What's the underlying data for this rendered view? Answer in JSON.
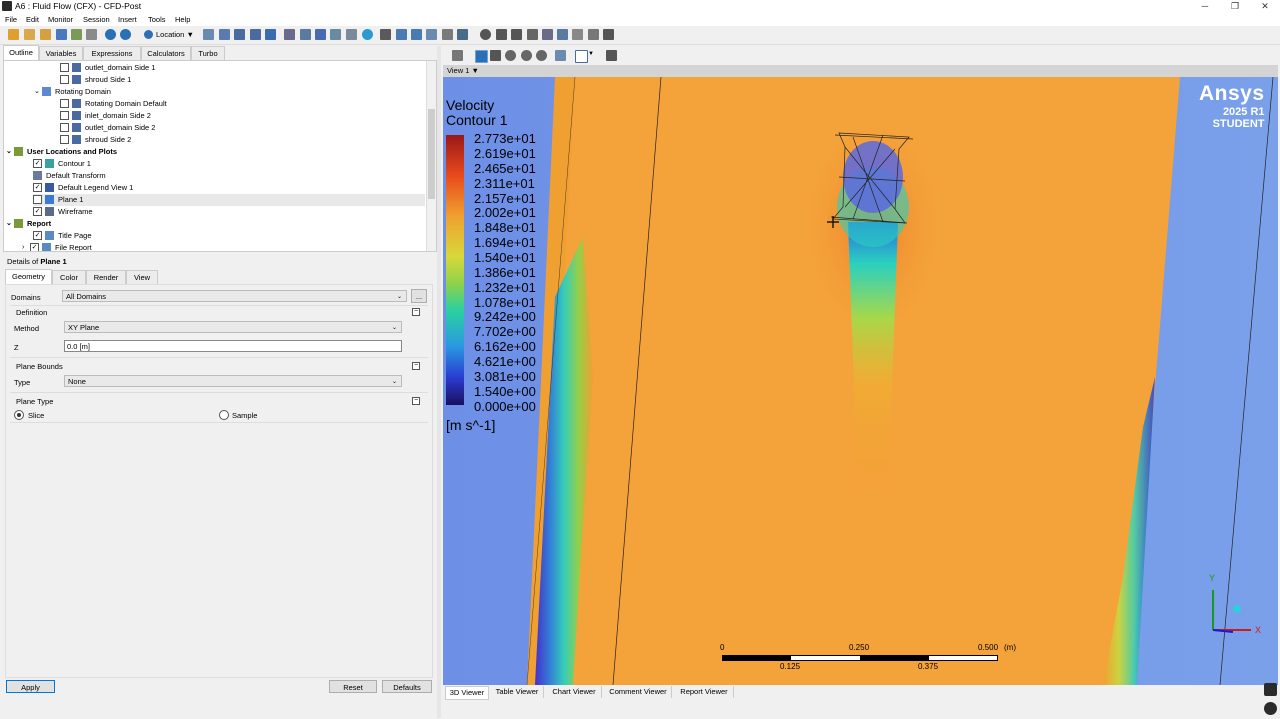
{
  "window": {
    "title": "A6 : Fluid Flow (CFX) - CFD-Post",
    "min": "─",
    "restore": "❐",
    "close": "✕"
  },
  "menu": [
    "File",
    "Edit",
    "Monitor",
    "Session",
    "Insert",
    "Tools",
    "Help"
  ],
  "toolbar": {
    "location_label": "Location"
  },
  "left_tabs": [
    "Outline",
    "Variables",
    "Expressions",
    "Calculators",
    "Turbo"
  ],
  "tree": [
    {
      "label": "outlet_domain Side 1",
      "checked": false
    },
    {
      "label": "shroud Side 1",
      "checked": false
    },
    {
      "label": "Rotating Domain"
    },
    {
      "label": "Rotating Domain Default",
      "checked": false
    },
    {
      "label": "inlet_domain Side 2",
      "checked": false
    },
    {
      "label": "outlet_domain Side 2",
      "checked": false
    },
    {
      "label": "shroud Side 2",
      "checked": false
    },
    {
      "label": "User Locations and Plots"
    },
    {
      "label": "Contour 1",
      "checked": true
    },
    {
      "label": "Default Transform"
    },
    {
      "label": "Default Legend View 1",
      "checked": true
    },
    {
      "label": "Plane 1",
      "checked": false
    },
    {
      "label": "Wireframe",
      "checked": true
    },
    {
      "label": "Report"
    },
    {
      "label": "Title Page",
      "checked": true
    },
    {
      "label": "File Report",
      "checked": true
    }
  ],
  "details": {
    "title_prefix": "Details of ",
    "title_object": "Plane 1",
    "tabs": [
      "Geometry",
      "Color",
      "Render",
      "View"
    ],
    "domains_label": "Domains",
    "domains_value": "All Domains",
    "more_button": "...",
    "definition_label": "Definition",
    "method_label": "Method",
    "method_value": "XY Plane",
    "z_label": "Z",
    "z_value": "0.0 [m]",
    "plane_bounds_label": "Plane Bounds",
    "type_label": "Type",
    "type_value": "None",
    "plane_type_label": "Plane Type",
    "slice_label": "Slice",
    "sample_label": "Sample",
    "apply": "Apply",
    "reset": "Reset",
    "defaults": "Defaults"
  },
  "viewer": {
    "view_label": "View 1",
    "legend_title": "Velocity",
    "legend_subtitle": "Contour 1",
    "legend_values": [
      "2.773e+01",
      "2.619e+01",
      "2.465e+01",
      "2.311e+01",
      "2.157e+01",
      "2.002e+01",
      "1.848e+01",
      "1.694e+01",
      "1.540e+01",
      "1.386e+01",
      "1.232e+01",
      "1.078e+01",
      "9.242e+00",
      "7.702e+00",
      "6.162e+00",
      "4.621e+00",
      "3.081e+00",
      "1.540e+00",
      "0.000e+00"
    ],
    "legend_unit": "[m s^-1]",
    "brand": "Ansys",
    "version": "2025 R1",
    "edition": "STUDENT",
    "scale_top": [
      "0",
      "0.250",
      "0.500",
      "(m)"
    ],
    "scale_bottom": [
      "0.125",
      "0.375"
    ],
    "axis_y": "Y",
    "axis_x": "X"
  },
  "bottom_tabs": [
    "3D Viewer",
    "Table Viewer",
    "Chart Viewer",
    "Comment Viewer",
    "Report Viewer"
  ],
  "colors": {
    "accent": "#0078d7",
    "contour_high": "#f08a2c",
    "contour_mid": "#8fd24a",
    "contour_low": "#2a3bd0"
  }
}
